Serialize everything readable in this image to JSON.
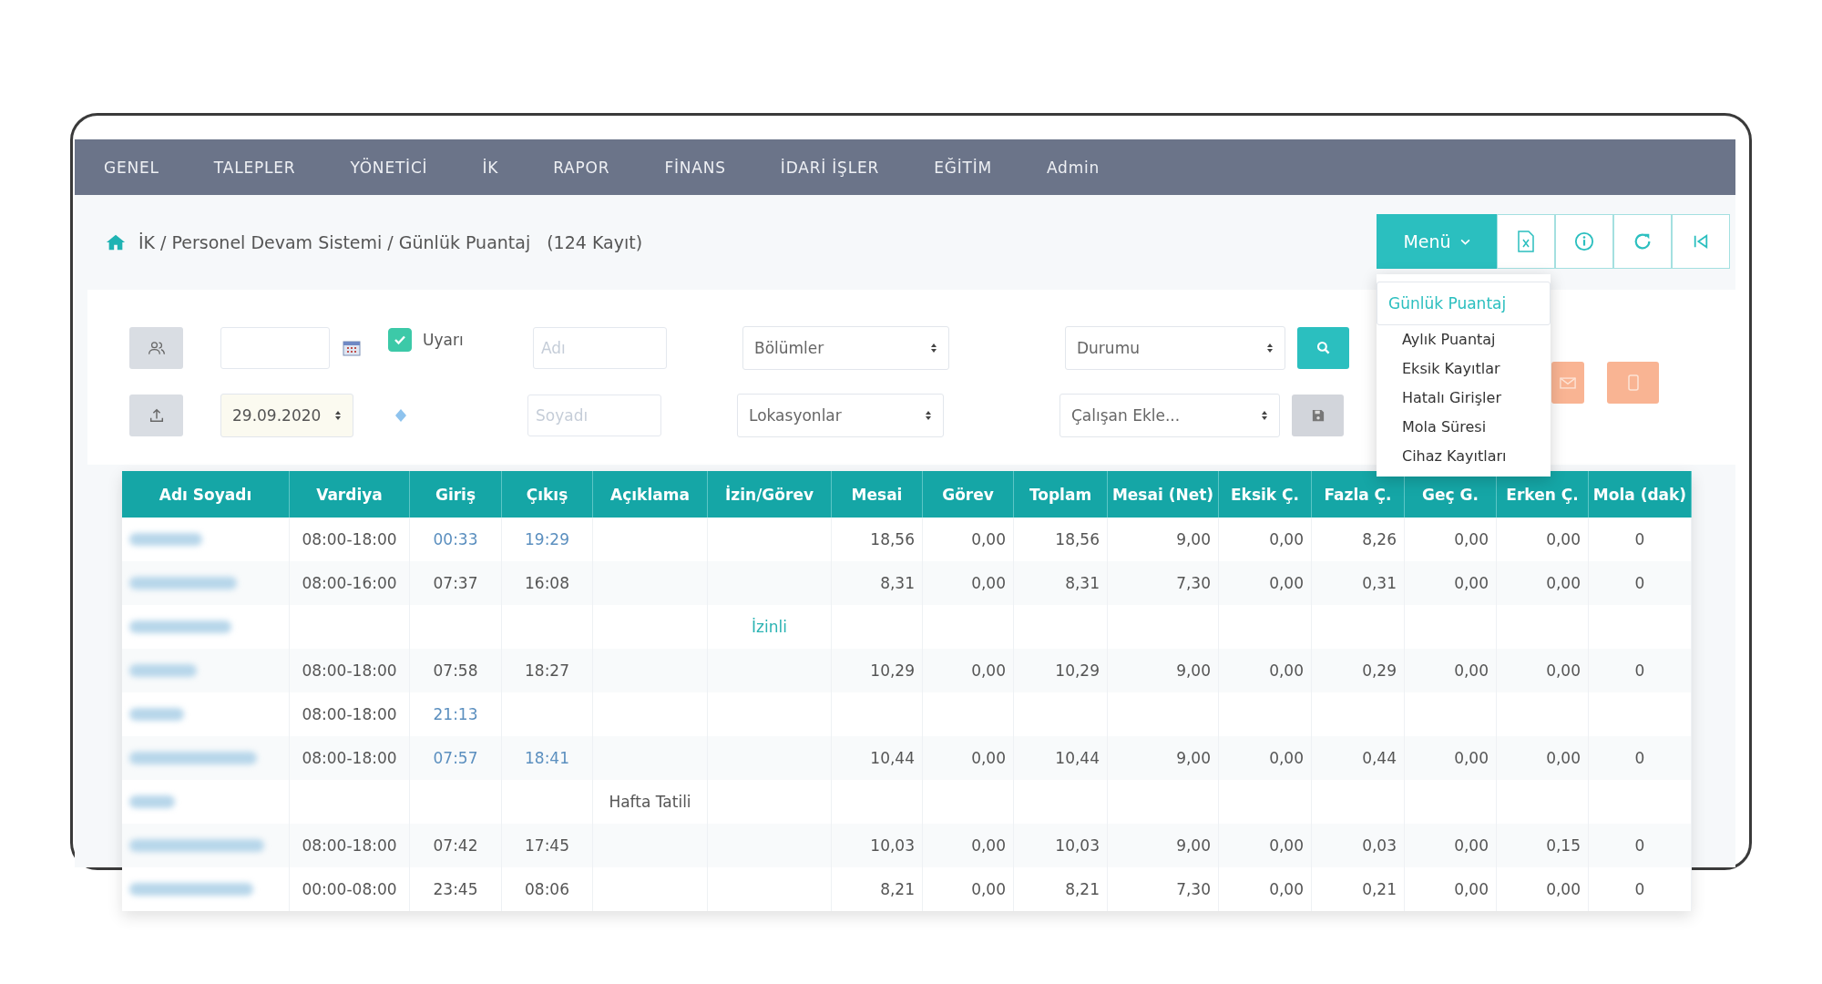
{
  "nav": {
    "items": [
      "GENEL",
      "TALEPLER",
      "YÖNETİCİ",
      "İK",
      "RAPOR",
      "FİNANS",
      "İDARİ İŞLER",
      "EĞİTİM",
      "Admin"
    ]
  },
  "breadcrumb": {
    "path": "İK / Personel Devam Sistemi / Günlük Puantaj",
    "count": "(124 Kayıt)"
  },
  "toolbar": {
    "menu_button": "Menü"
  },
  "menu": {
    "items": [
      {
        "label": "Günlük Puantaj",
        "selected": true
      },
      {
        "label": "Aylık Puantaj",
        "selected": false
      },
      {
        "label": "Eksik Kayıtlar",
        "selected": false
      },
      {
        "label": "Hatalı Girişler",
        "selected": false
      },
      {
        "label": "Mola Süresi",
        "selected": false
      },
      {
        "label": "Cihaz Kayıtları",
        "selected": false
      }
    ]
  },
  "filters": {
    "warning": {
      "label": "Uyarı",
      "checked": true
    },
    "first_name": {
      "placeholder": "Adı"
    },
    "last_name": {
      "placeholder": "Soyadı"
    },
    "departments": "Bölümler",
    "locations": "Lokasyonlar",
    "status": "Durumu",
    "add_employee": "Çalışan Ekle...",
    "date": "29.09.2020"
  },
  "table": {
    "columns": [
      {
        "label": "Adı Soyadı",
        "kind": "name"
      },
      {
        "label": "Vardiya",
        "kind": "text"
      },
      {
        "label": "Giriş",
        "kind": "time"
      },
      {
        "label": "Çıkış",
        "kind": "time"
      },
      {
        "label": "Açıklama",
        "kind": "text"
      },
      {
        "label": "İzin/Görev",
        "kind": "leave"
      },
      {
        "label": "Mesai",
        "kind": "number"
      },
      {
        "label": "Görev",
        "kind": "number"
      },
      {
        "label": "Toplam",
        "kind": "number"
      },
      {
        "label": "Mesai (Net)",
        "kind": "number"
      },
      {
        "label": "Eksik Ç.",
        "kind": "number"
      },
      {
        "label": "Fazla Ç.",
        "kind": "number"
      },
      {
        "label": "Geç G.",
        "kind": "number"
      },
      {
        "label": "Erken Ç.",
        "kind": "number"
      },
      {
        "label": "Mola (dak)",
        "kind": "count"
      }
    ],
    "rows": [
      {
        "time_flagged": true,
        "cells": [
          null,
          "08:00-18:00",
          "00:33",
          "19:29",
          null,
          null,
          "18,56",
          "0,00",
          "18,56",
          "9,00",
          "0,00",
          "8,26",
          "0,00",
          "0,00",
          "0"
        ]
      },
      {
        "time_flagged": false,
        "cells": [
          null,
          "08:00-16:00",
          "07:37",
          "16:08",
          null,
          null,
          "8,31",
          "0,00",
          "8,31",
          "7,30",
          "0,00",
          "0,31",
          "0,00",
          "0,00",
          "0"
        ]
      },
      {
        "cells": [
          null,
          null,
          null,
          null,
          null,
          "İzinli",
          null,
          null,
          null,
          null,
          null,
          null,
          null,
          null,
          null
        ]
      },
      {
        "time_flagged": false,
        "cells": [
          null,
          "08:00-18:00",
          "07:58",
          "18:27",
          null,
          null,
          "10,29",
          "0,00",
          "10,29",
          "9,00",
          "0,00",
          "0,29",
          "0,00",
          "0,00",
          "0"
        ]
      },
      {
        "time_flagged": true,
        "cells": [
          null,
          "08:00-18:00",
          "21:13",
          null,
          null,
          null,
          null,
          null,
          null,
          null,
          null,
          null,
          null,
          null,
          null
        ]
      },
      {
        "time_flagged": true,
        "cells": [
          null,
          "08:00-18:00",
          "07:57",
          "18:41",
          null,
          null,
          "10,44",
          "0,00",
          "10,44",
          "9,00",
          "0,00",
          "0,44",
          "0,00",
          "0,00",
          "0"
        ]
      },
      {
        "cells": [
          null,
          null,
          null,
          null,
          "Hafta Tatili",
          null,
          null,
          null,
          null,
          null,
          null,
          null,
          null,
          null,
          null
        ]
      },
      {
        "time_flagged": false,
        "cells": [
          null,
          "08:00-18:00",
          "07:42",
          "17:45",
          null,
          null,
          "10,03",
          "0,00",
          "10,03",
          "9,00",
          "0,00",
          "0,03",
          "0,00",
          "0,15",
          "0"
        ]
      },
      {
        "time_flagged": false,
        "cells": [
          null,
          "00:00-08:00",
          "23:45",
          "08:06",
          null,
          null,
          "8,21",
          "0,00",
          "8,21",
          "7,30",
          "0,00",
          "0,21",
          "0,00",
          "0,00",
          "0"
        ]
      }
    ]
  }
}
